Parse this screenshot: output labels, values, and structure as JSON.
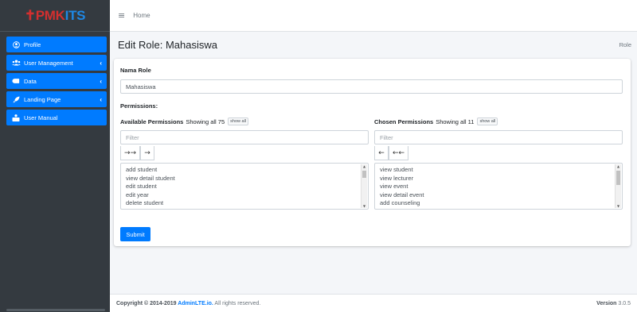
{
  "brand": {
    "cross": "✝",
    "pmk": "PMK",
    "its": "ITS"
  },
  "sidebar": {
    "items": [
      {
        "label": "Profile",
        "icon": "user-circle-icon",
        "has_arrow": false
      },
      {
        "label": "User Management",
        "icon": "users-icon",
        "has_arrow": true
      },
      {
        "label": "Data",
        "icon": "database-icon",
        "has_arrow": true
      },
      {
        "label": "Landing Page",
        "icon": "rocket-icon",
        "has_arrow": true
      },
      {
        "label": "User Manual",
        "icon": "user-manual-icon",
        "has_arrow": false
      }
    ],
    "arrow": "‹"
  },
  "topbar": {
    "menu_icon": "≡",
    "home": "Home"
  },
  "header": {
    "title": "Edit Role: Mahasiswa",
    "breadcrumb": "Role"
  },
  "form": {
    "role_label": "Nama Role",
    "role_value": "Mahasiswa",
    "permissions_label": "Permissions:",
    "available": {
      "title": "Available Permissions",
      "showing": "Showing all 75",
      "show_all": "show all",
      "filter_placeholder": "Filter",
      "move_all": "→→",
      "move_one": "→",
      "options": [
        "add student",
        "view detail student",
        "edit student",
        "edit year",
        "delete student"
      ]
    },
    "chosen": {
      "title": "Chosen Permissions",
      "showing": "Showing all 11",
      "show_all": "show all",
      "filter_placeholder": "Filter",
      "move_one": "←",
      "move_all": "←←",
      "options": [
        "view student",
        "view lecturer",
        "view event",
        "view detail event",
        "add counseling"
      ]
    },
    "submit": "Submit"
  },
  "footer": {
    "copyright_prefix": "Copyright © 2014-2019 ",
    "copyright_link": "AdminLTE.io.",
    "copyright_suffix": " All rights reserved.",
    "version_label": "Version",
    "version_value": "3.0.5"
  },
  "colors": {
    "primary": "#007bff",
    "sidebar": "#343a40",
    "brand_red": "#d32f2f",
    "brand_blue": "#1e88e5"
  }
}
